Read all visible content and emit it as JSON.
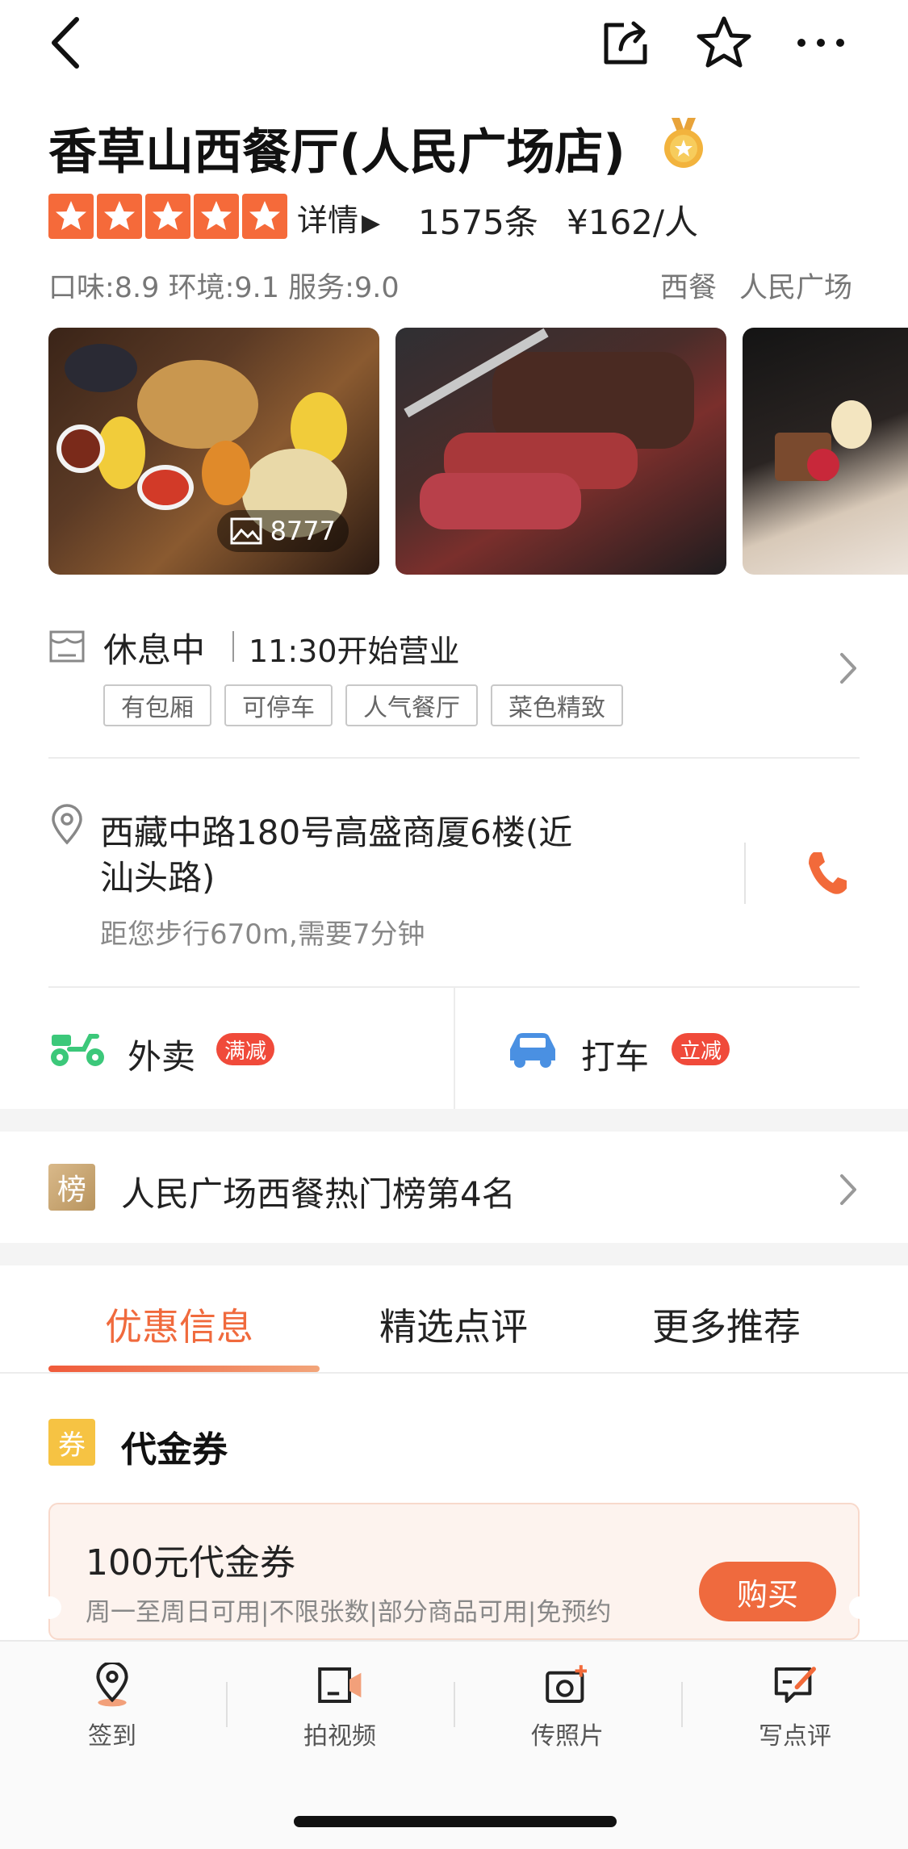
{
  "shop": {
    "name": "香草山西餐厅(人民广场店)",
    "detail_link": "详情",
    "review_count": "1575条",
    "price": "¥162/人",
    "rating_stars": 5,
    "scores": "口味:8.9 环境:9.1 服务:9.0",
    "category": "西餐",
    "area": "人民广场"
  },
  "photos": {
    "count": "8777"
  },
  "hours": {
    "status": "休息中",
    "open_text": "11:30开始营业",
    "tags": [
      "有包厢",
      "可停车",
      "人气餐厅",
      "菜色精致"
    ]
  },
  "address": {
    "line1": "西藏中路180号高盛商厦6楼(近",
    "line2": "汕头路)",
    "walk": "距您步行670m,需要7分钟"
  },
  "services": {
    "takeout_label": "外卖",
    "takeout_badge": "满减",
    "taxi_label": "打车",
    "taxi_badge": "立减"
  },
  "rank": {
    "icon_text": "榜",
    "text": "人民广场西餐热门榜第4名"
  },
  "tabs": [
    "优惠信息",
    "精选点评",
    "更多推荐"
  ],
  "coupon": {
    "icon_text": "券",
    "section_title": "代金券",
    "title": "100元代金券",
    "desc": "周一至周日可用|不限张数|部分商品可用|免预约",
    "buy_label": "购买"
  },
  "bottom_bar": [
    {
      "label": "签到",
      "icon": "checkin-pin-icon"
    },
    {
      "label": "拍视频",
      "icon": "video-icon"
    },
    {
      "label": "传照片",
      "icon": "camera-plus-icon"
    },
    {
      "label": "写点评",
      "icon": "write-review-icon"
    }
  ],
  "colors": {
    "accent": "#f06a3d",
    "star": "#f56a3a",
    "badge": "#f04a3a",
    "takeout_green": "#3cc87a",
    "taxi_blue": "#4a90e2"
  }
}
